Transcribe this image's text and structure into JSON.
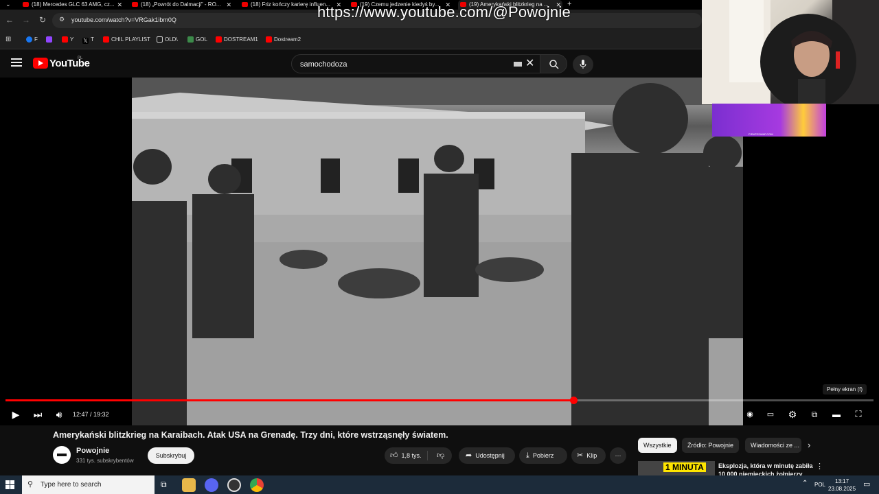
{
  "browser": {
    "tabs": [
      {
        "label": "(18) Mercedes GLC 63 AMG, cz..."
      },
      {
        "label": "(18) „Powrót do Dalmacji” - RO..."
      },
      {
        "label": "(18) Friz kończy karierę influen..."
      },
      {
        "label": "(19) Czemu jedzenie kiedyś by..."
      },
      {
        "label": "(19) Amerykański blitzkrieg na ..."
      }
    ],
    "new_tab_label": "+",
    "url": "youtube.com/watch?v=VRGak1ibm0Q",
    "bookmarks": [
      "F",
      "",
      "Y",
      "T",
      "CHIL PLAYLIST",
      "OLD\\",
      "GOL",
      "DOSTREAM1",
      "Dostream2"
    ]
  },
  "watermark": "https://www.youtube.com/@Powojnie",
  "youtube": {
    "logo_text": "YouTube",
    "country_code": "PL",
    "search_value": "samochodoza"
  },
  "player": {
    "tooltip": "Pełny ekran (f)",
    "time": "12:47 / 19:32",
    "progress_fraction": 0.6544
  },
  "ad": {
    "caption": "PIRATESWAP.COM"
  },
  "video": {
    "title": "Amerykański blitzkrieg na Karaibach. Atak USA na Grenadę. Trzy dni, które wstrząsnęły światem.",
    "channel_name": "Powojnie",
    "subscribers": "331 tys. subskrybentów",
    "subscribe_label": "Subskrybuj",
    "likes": "1,8 tys.",
    "share_label": "Udostępnij",
    "download_label": "Pobierz",
    "clip_label": "Klip",
    "more_label": "⋯"
  },
  "chips": [
    "Wszystkie",
    "Źródło: Powojnie",
    "Wiadomości ze ..."
  ],
  "recommendation": {
    "thumb_tag": "1 MINUTA",
    "title": "Eksplozja, która w minutę zabiła 10 000 niemieckich żołnierzy"
  },
  "taskbar": {
    "search_placeholder": "Type here to search",
    "lang": "POL",
    "time": "13:17",
    "date": "23.08.2025"
  },
  "colors": {
    "accent": "#ff0000",
    "background": "#0f0f0f",
    "taskbar": "#1c2b3a"
  }
}
